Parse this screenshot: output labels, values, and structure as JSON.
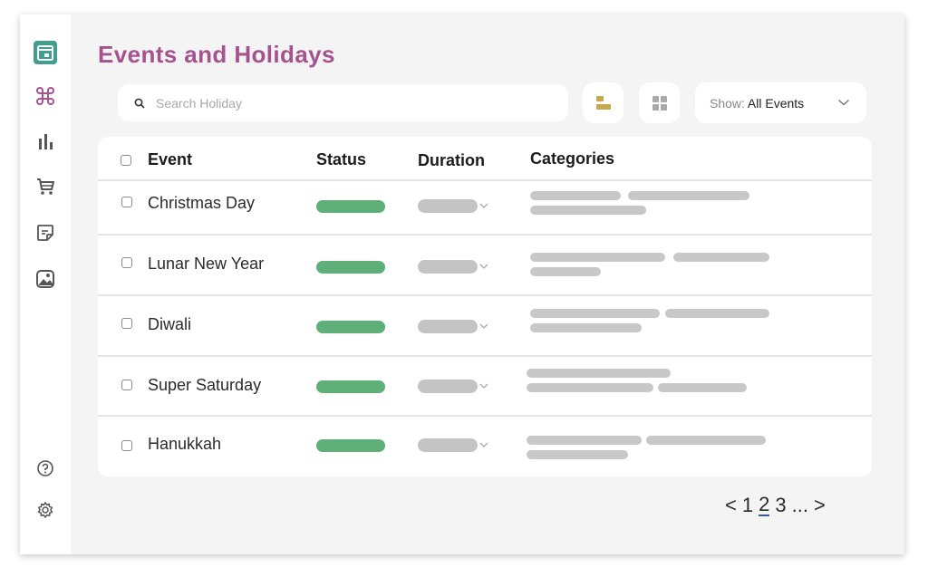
{
  "page": {
    "title": "Events and Holidays"
  },
  "search": {
    "placeholder": "Search Holiday",
    "value": ""
  },
  "view_buttons": [
    {
      "name": "list-view-icon",
      "color": "#c5a94c"
    },
    {
      "name": "grid-view-icon",
      "color": "#aaaaaa"
    }
  ],
  "filter": {
    "label": "Show:",
    "value": "All Events"
  },
  "sidebar": {
    "items": [
      {
        "name": "calendar-icon",
        "active": true
      },
      {
        "name": "command-icon",
        "color": "#a5538f"
      },
      {
        "name": "bar-chart-icon"
      },
      {
        "name": "cart-icon"
      },
      {
        "name": "note-icon"
      },
      {
        "name": "image-icon"
      }
    ],
    "bottom": [
      {
        "name": "help-icon"
      },
      {
        "name": "settings-icon"
      }
    ]
  },
  "table": {
    "headers": {
      "event": "Event",
      "status": "Status",
      "duration": "Duration",
      "categories": "Categories"
    },
    "rows": [
      {
        "event": "Christmas Day"
      },
      {
        "event": "Lunar New Year"
      },
      {
        "event": "Diwali"
      },
      {
        "event": "Super Saturday"
      },
      {
        "event": "Hanukkah"
      }
    ]
  },
  "pagination": {
    "prev": "<",
    "pages": [
      "1",
      "2",
      "3"
    ],
    "current": "2",
    "ellipsis": "...",
    "next": ">"
  },
  "colors": {
    "accent": "#a5538f",
    "sidebar_active": "#3f9e8f",
    "status": "#5faf78",
    "placeholder": "#c8c8c8"
  }
}
